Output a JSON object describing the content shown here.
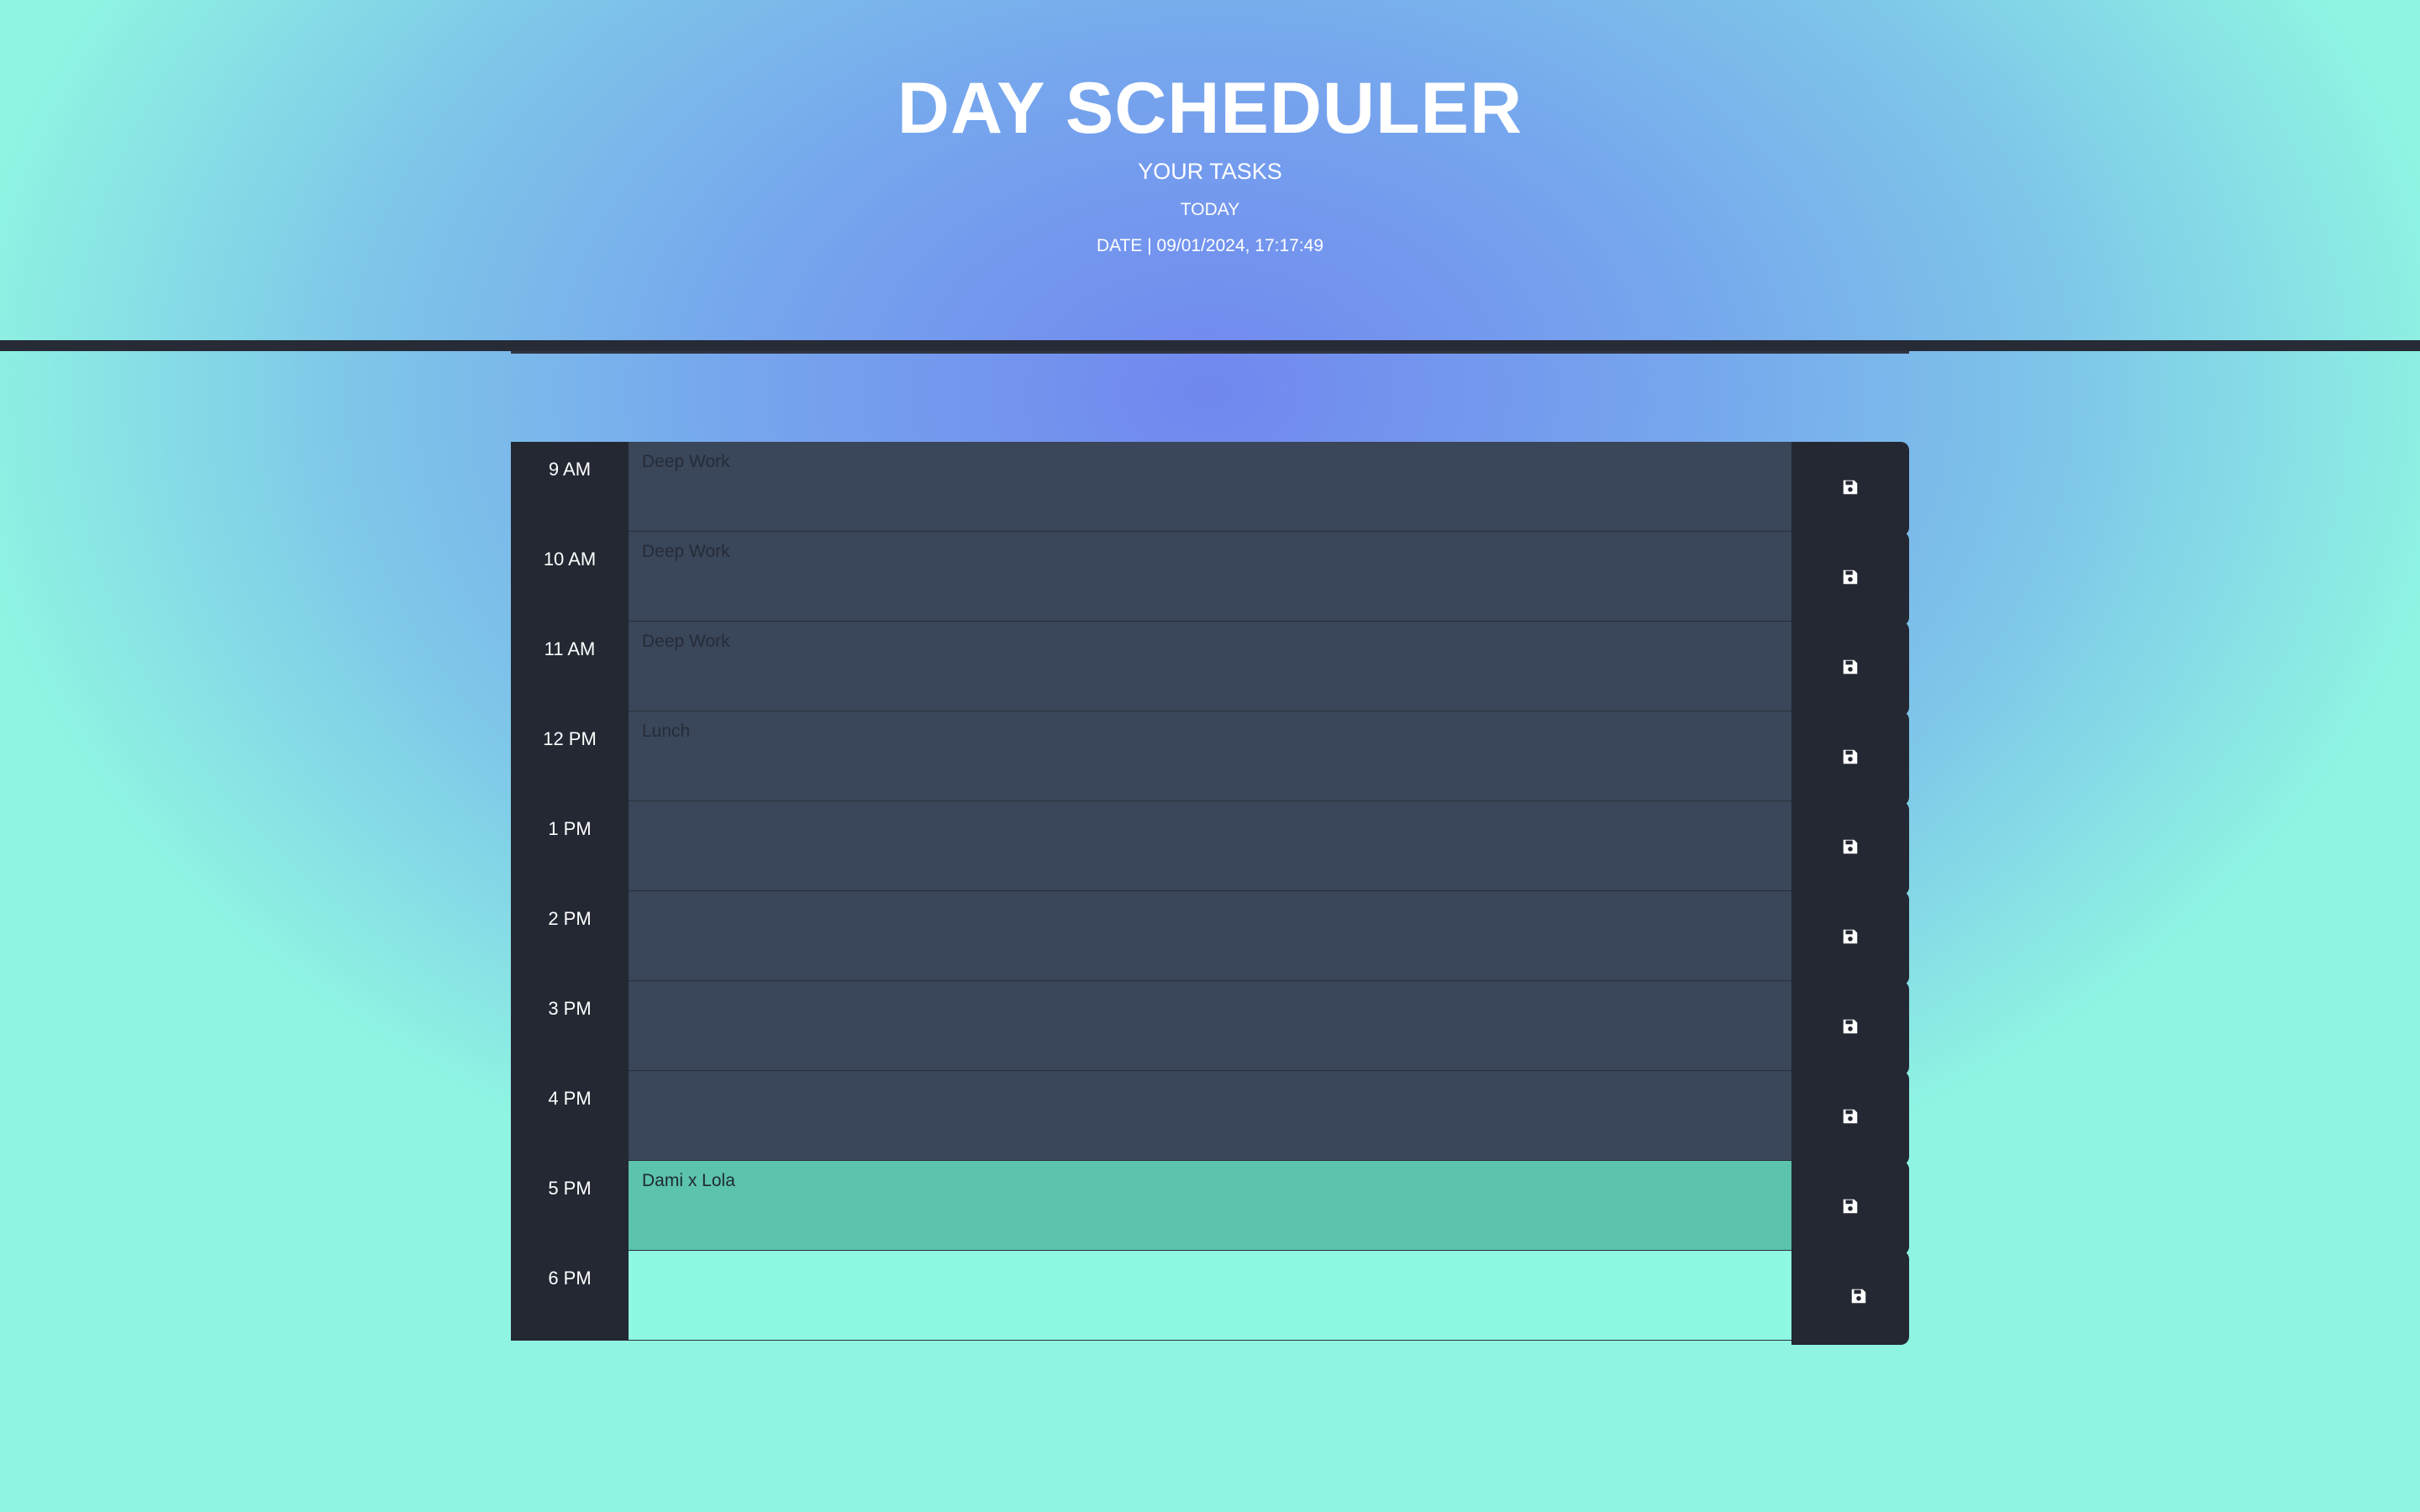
{
  "header": {
    "title": "DAY SCHEDULER",
    "subtitle": "YOUR TASKS",
    "today_label": "TODAY",
    "datetime": "DATE | 09/01/2024, 17:17:49"
  },
  "schedule": {
    "rows": [
      {
        "hour": "9 AM",
        "task": "Deep Work",
        "state": "past"
      },
      {
        "hour": "10 AM",
        "task": "Deep Work",
        "state": "past"
      },
      {
        "hour": "11 AM",
        "task": "Deep Work",
        "state": "past"
      },
      {
        "hour": "12 PM",
        "task": "Lunch",
        "state": "past"
      },
      {
        "hour": "1 PM",
        "task": "",
        "state": "past"
      },
      {
        "hour": "2 PM",
        "task": "",
        "state": "past"
      },
      {
        "hour": "3 PM",
        "task": "",
        "state": "past"
      },
      {
        "hour": "4 PM",
        "task": "",
        "state": "past"
      },
      {
        "hour": "5 PM",
        "task": "Dami x Lola",
        "state": "present"
      },
      {
        "hour": "6 PM",
        "task": "",
        "state": "future"
      }
    ],
    "save_icon": "floppy-disk-icon"
  },
  "colors": {
    "past": "#3a465a",
    "present": "#5cc3ad",
    "future": "#8ef9e3",
    "hour_column": "#232833"
  }
}
